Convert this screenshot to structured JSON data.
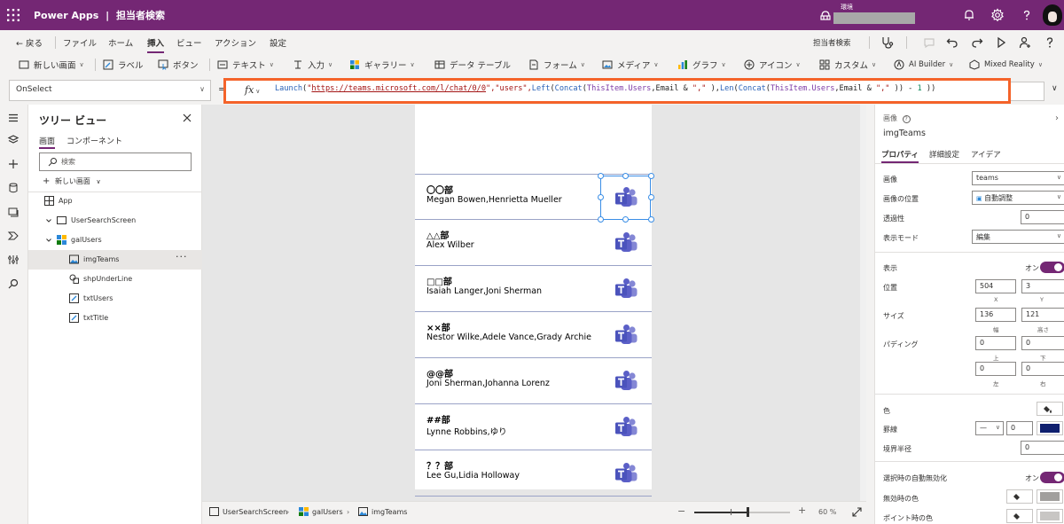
{
  "titlebar": {
    "app_name": "Power Apps",
    "separator": "|",
    "document_title": "担当者検索",
    "env_label": "環境"
  },
  "menubar": {
    "back": "戻る",
    "items": [
      "ファイル",
      "ホーム",
      "挿入",
      "ビュー",
      "アクション",
      "設定"
    ],
    "active_item": "挿入",
    "app_name_right": "担当者検索"
  },
  "toolbar": {
    "items": [
      "新しい画面",
      "ラベル",
      "ボタン",
      "テキスト",
      "入力",
      "ギャラリー",
      "データ テーブル",
      "フォーム",
      "メディア",
      "グラフ",
      "アイコン",
      "カスタム",
      "AI Builder",
      "Mixed Reality"
    ]
  },
  "formula": {
    "property": "OnSelect",
    "equals": "=",
    "fx": "fx",
    "tokens": [
      {
        "t": "Launch",
        "c": "f-fn"
      },
      {
        "t": "(",
        "c": "f-p"
      },
      {
        "t": "\"",
        "c": "f-str"
      },
      {
        "t": "https://teams.microsoft.com/l/chat/0/0",
        "c": "f-url"
      },
      {
        "t": "\",\"users\",",
        "c": "f-str"
      },
      {
        "t": "Left",
        "c": "f-fn"
      },
      {
        "t": "(",
        "c": "f-p"
      },
      {
        "t": "Concat",
        "c": "f-fn"
      },
      {
        "t": "(",
        "c": "f-p"
      },
      {
        "t": "ThisItem.Users",
        "c": "f-id"
      },
      {
        "t": ",Email & ",
        "c": "f-p"
      },
      {
        "t": "\",\"",
        "c": "f-str"
      },
      {
        "t": " ),",
        "c": "f-p"
      },
      {
        "t": "Len",
        "c": "f-fn"
      },
      {
        "t": "(",
        "c": "f-p"
      },
      {
        "t": "Concat",
        "c": "f-fn"
      },
      {
        "t": "(",
        "c": "f-p"
      },
      {
        "t": "ThisItem.Users",
        "c": "f-id"
      },
      {
        "t": ",Email & ",
        "c": "f-p"
      },
      {
        "t": "\",\"",
        "c": "f-str"
      },
      {
        "t": " )) - ",
        "c": "f-p"
      },
      {
        "t": "1",
        "c": "f-num"
      },
      {
        "t": " ))",
        "c": "f-p"
      }
    ]
  },
  "tree": {
    "title": "ツリー ビュー",
    "tabs": [
      "画面",
      "コンポーネント"
    ],
    "search_placeholder": "検索",
    "new_screen": "新しい画面",
    "items": [
      {
        "label": "App",
        "level": 0,
        "icon": "app"
      },
      {
        "label": "UserSearchScreen",
        "level": 0,
        "icon": "screen"
      },
      {
        "label": "galUsers",
        "level": 1,
        "icon": "gallery"
      },
      {
        "label": "imgTeams",
        "level": 2,
        "icon": "image",
        "selected": true
      },
      {
        "label": "shpUnderLine",
        "level": 2,
        "icon": "shape"
      },
      {
        "label": "txtUsers",
        "level": 2,
        "icon": "label"
      },
      {
        "label": "txtTitle",
        "level": 2,
        "icon": "label"
      }
    ]
  },
  "gallery": {
    "items": [
      {
        "title": "〇〇部",
        "users": "Megan Bowen,Henrietta Mueller"
      },
      {
        "title": "△△部",
        "users": "Alex Wilber"
      },
      {
        "title": "□□部",
        "users": "Isaiah Langer,Joni Sherman"
      },
      {
        "title": "××部",
        "users": "Nestor Wilke,Adele Vance,Grady Archie"
      },
      {
        "title": "@@部",
        "users": "Joni Sherman,Johanna Lorenz"
      },
      {
        "title": "##部",
        "users": "Lynne Robbins,ゆり"
      },
      {
        "title": "？？部",
        "users": "Lee Gu,Lidia Holloway"
      }
    ]
  },
  "statusbar": {
    "crumbs": [
      "UserSearchScreen",
      "galUsers",
      "imgTeams"
    ],
    "zoom": "60 %",
    "zoom_level": 0.6
  },
  "props": {
    "type_label": "画像",
    "control_name": "imgTeams",
    "tabs": [
      "プロパティ",
      "詳細設定",
      "アイデア"
    ],
    "image_label": "画像",
    "image_value": "teams",
    "position_label": "画像の位置",
    "position_value": "自動調整",
    "transparency_label": "透過性",
    "transparency_value": "0",
    "display_mode_label": "表示モード",
    "display_mode_value": "編集",
    "visible_label": "表示",
    "visible_value": "オン",
    "pos_label": "位置",
    "x_value": "504",
    "y_value": "3",
    "x_sub": "X",
    "y_sub": "Y",
    "size_label": "サイズ",
    "w_value": "136",
    "h_value": "121",
    "w_sub": "幅",
    "h_sub": "高さ",
    "padding_label": "パディング",
    "pad_top": "0",
    "pad_bottom": "0",
    "pad_left": "0",
    "pad_right": "0",
    "pad_top_sub": "上",
    "pad_bottom_sub": "下",
    "pad_left_sub": "左",
    "pad_right_sub": "右",
    "color_label": "色",
    "border_label": "罫線",
    "border_width": "0",
    "border_color": "#0f1f6e",
    "radius_label": "境界半径",
    "radius_value": "0",
    "autodisable_label": "選択時の自動無効化",
    "autodisable_value": "オン",
    "disabled_color_label": "無効時の色",
    "hover_color_label": "ポイント時の色",
    "disabled_swatch": "#a19f9d",
    "hover_swatch": "#c8c6c4"
  },
  "colors": {
    "brand": "#742774",
    "highlight": "#f4632a",
    "teams": "#5b5fc7"
  }
}
